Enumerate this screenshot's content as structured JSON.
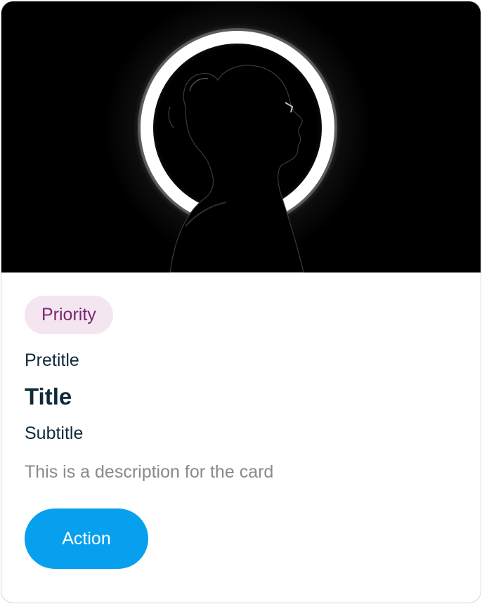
{
  "card": {
    "image": {
      "subject": "silhouette-with-ring-light"
    },
    "chip_label": "Priority",
    "pretitle": "Pretitle",
    "title": "Title",
    "subtitle": "Subtitle",
    "description": "This is a description for the card",
    "action_label": "Action"
  },
  "colors": {
    "chip_bg": "#f3e6f1",
    "chip_text": "#7b2670",
    "text_primary": "#0f2a3a",
    "text_secondary": "#8a8a8a",
    "action_bg": "#06a0ef",
    "action_text": "#ffffff",
    "media_bg": "#000000"
  }
}
